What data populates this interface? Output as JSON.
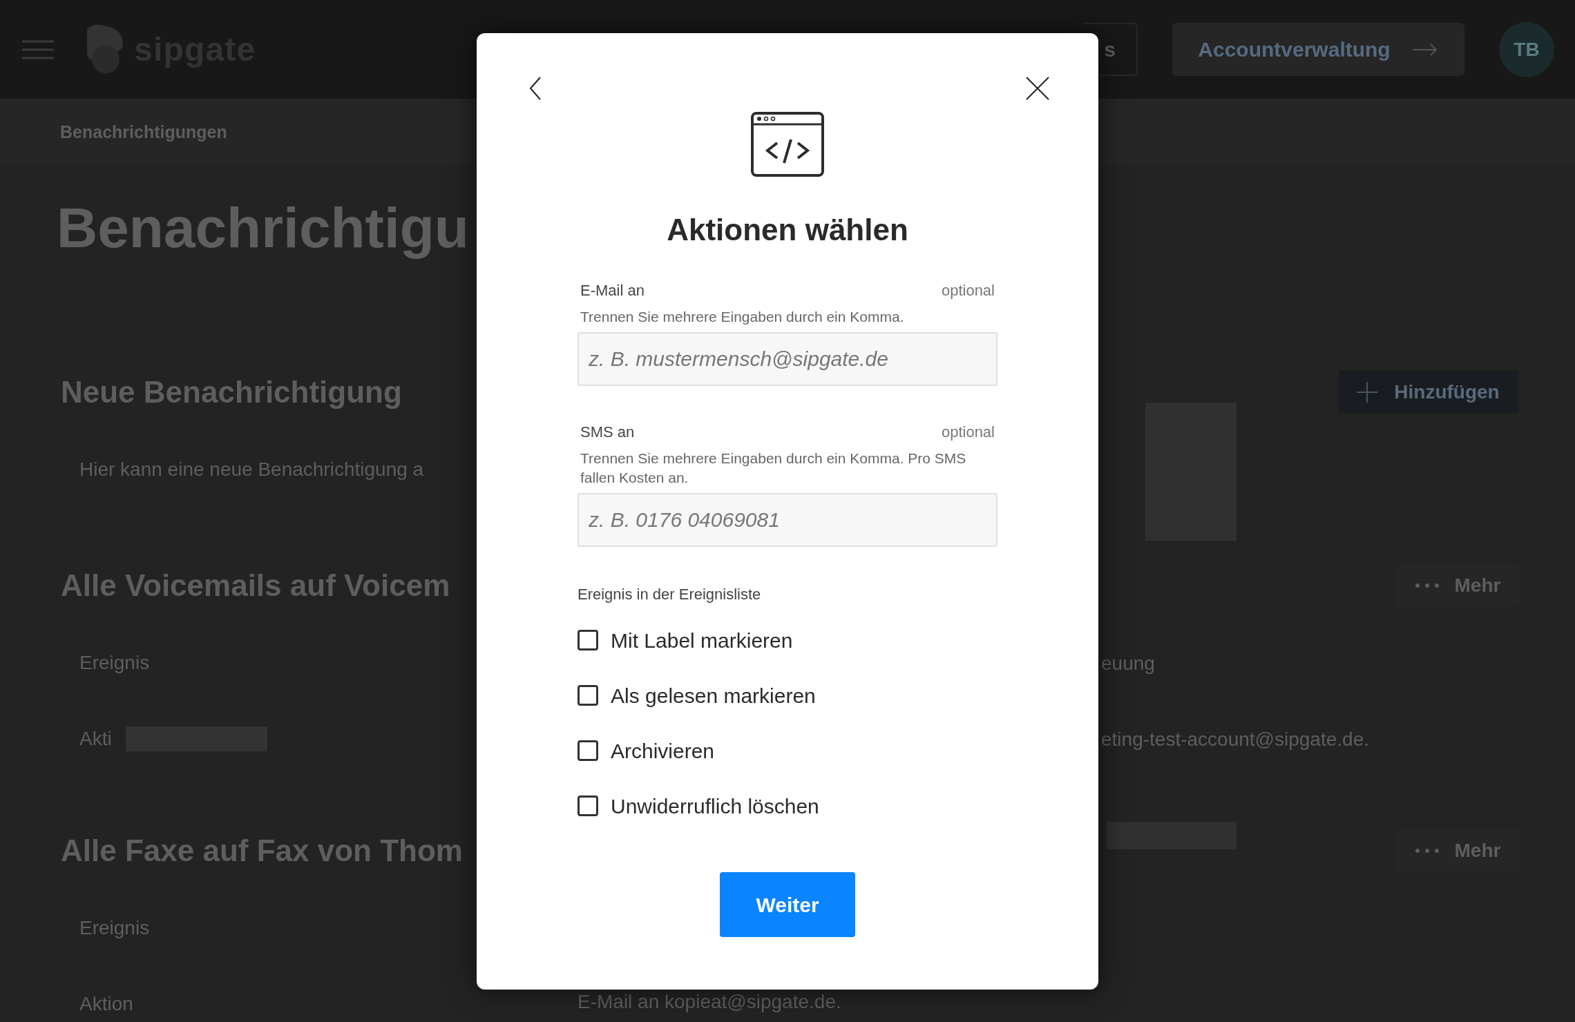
{
  "header": {
    "logo": "sipgate",
    "partial_button": "s",
    "account_button": "Accountverwaltung",
    "avatar": "TB"
  },
  "breadcrumb": "Benachrichtigungen",
  "page_title": "Benachrichtigu",
  "sections": [
    {
      "title": "Neue Benachrichtigung",
      "rows": [
        {
          "text": "Hier kann eine neue Benachrichtigung a",
          "skeleton": false
        }
      ]
    },
    {
      "title": "Alle Voicemails auf Voicem",
      "rows": [
        {
          "text": "Ereignis",
          "skeleton": false
        },
        {
          "text": "Akti",
          "skeleton": true
        }
      ]
    },
    {
      "title": "Alle Faxe auf Fax von Thom",
      "rows": [
        {
          "text": "Ereignis",
          "skeleton": false
        },
        {
          "text": "Aktion",
          "skeleton": false
        }
      ]
    }
  ],
  "middle_text": "E-Mail an kopieat@sipgate.de.",
  "right": {
    "add_button": "Hinzufügen",
    "more_buttons": [
      "Mehr",
      "Mehr"
    ],
    "texts": [
      "euung",
      "eting-test-account@sipgate.de."
    ]
  },
  "modal": {
    "title": "Aktionen wählen",
    "fields": [
      {
        "label": "E-Mail an",
        "optional": "optional",
        "hint": "Trennen Sie mehrere Eingaben durch ein Komma.",
        "placeholder": "z. B. mustermensch@sipgate.de"
      },
      {
        "label": "SMS an",
        "optional": "optional",
        "hint": "Trennen Sie mehrere Eingaben durch ein Komma. Pro SMS fallen Kosten an.",
        "placeholder": "z. B. 0176 04069081"
      }
    ],
    "group_label": "Ereignis in der Ereignisliste",
    "options": [
      {
        "label": "Mit Label markieren",
        "checked": false
      },
      {
        "label": "Als gelesen markieren",
        "checked": false
      },
      {
        "label": "Archivieren",
        "checked": false
      },
      {
        "label": "Unwiderruflich löschen",
        "checked": false
      }
    ],
    "submit": "Weiter"
  }
}
